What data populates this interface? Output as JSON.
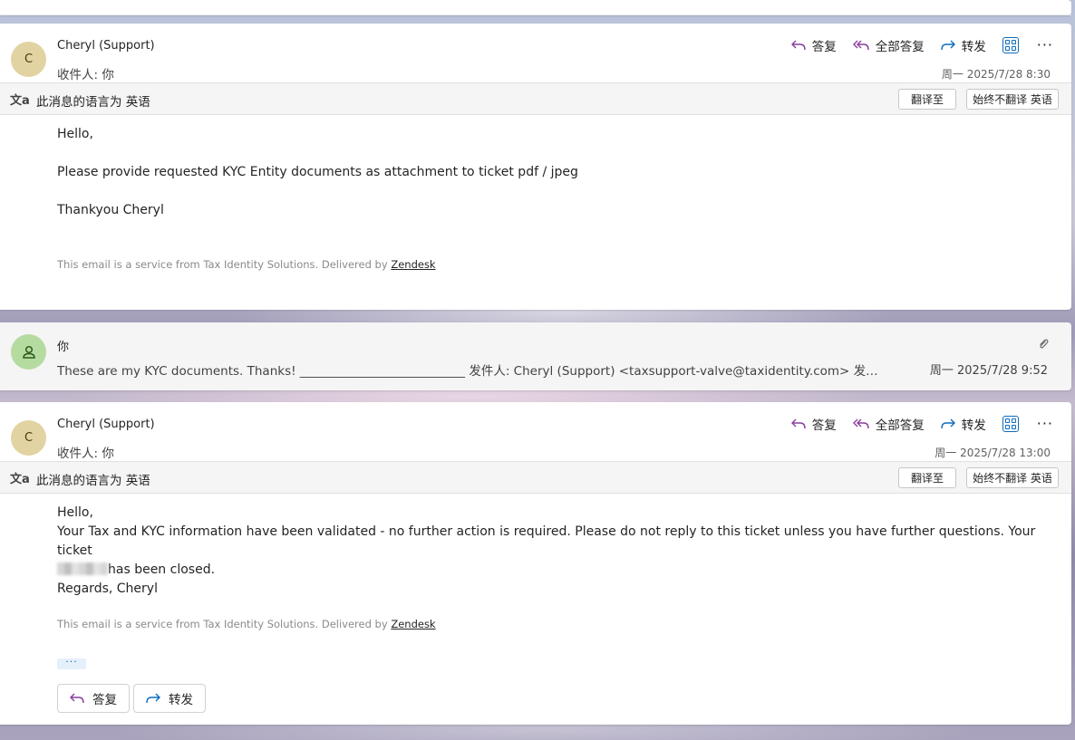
{
  "messages": [
    {
      "avatar_letter": "C",
      "sender": "Cheryl (Support)",
      "to_label": "收件人:",
      "to_value": "你",
      "date": "周一 2025/7/28 8:30",
      "actions": {
        "reply": "答复",
        "reply_all": "全部答复",
        "forward": "转发"
      },
      "translate": {
        "label": "此消息的语言为 英语",
        "translate_to": "翻译至",
        "never_translate": "始终不翻译 英语"
      },
      "body": [
        "Hello,",
        "Please provide requested KYC Entity documents as attachment to ticket pdf / jpeg",
        "Thankyou Cheryl"
      ],
      "footer_text": "This email is a service from Tax Identity Solutions. Delivered by",
      "footer_link": "Zendesk"
    },
    {
      "avatar_letter": "",
      "sender": "你",
      "preview": "These are my KYC documents. Thanks! ___________________________ 发件人: Cheryl (Support) <taxsupport-valve@taxidentity.com> 发送时间: 20...",
      "date": "周一 2025/7/28 9:52"
    },
    {
      "avatar_letter": "C",
      "sender": "Cheryl (Support)",
      "to_label": "收件人:",
      "to_value": "你",
      "date": "周一 2025/7/28 13:00",
      "actions": {
        "reply": "答复",
        "reply_all": "全部答复",
        "forward": "转发"
      },
      "translate": {
        "label": "此消息的语言为 英语",
        "translate_to": "翻译至",
        "never_translate": "始终不翻译 英语"
      },
      "body": [
        "Hello,",
        "Your Tax and KYC information have been validated - no further action is required. Please do not reply to this ticket unless you have further questions. Your ticket",
        "has been closed.",
        "Regards, Cheryl"
      ],
      "footer_text": "This email is a service from Tax Identity Solutions. Delivered by",
      "footer_link": "Zendesk",
      "more_dots": "···",
      "bottom_reply": "答复",
      "bottom_forward": "转发"
    }
  ],
  "colors": {
    "accent": "#0f6cbd",
    "reply_icon": "#8a3e9e",
    "forward_icon": "#0f6cbd",
    "avatar_c": "#e2d3a2",
    "avatar_me": "#b6dba0"
  }
}
